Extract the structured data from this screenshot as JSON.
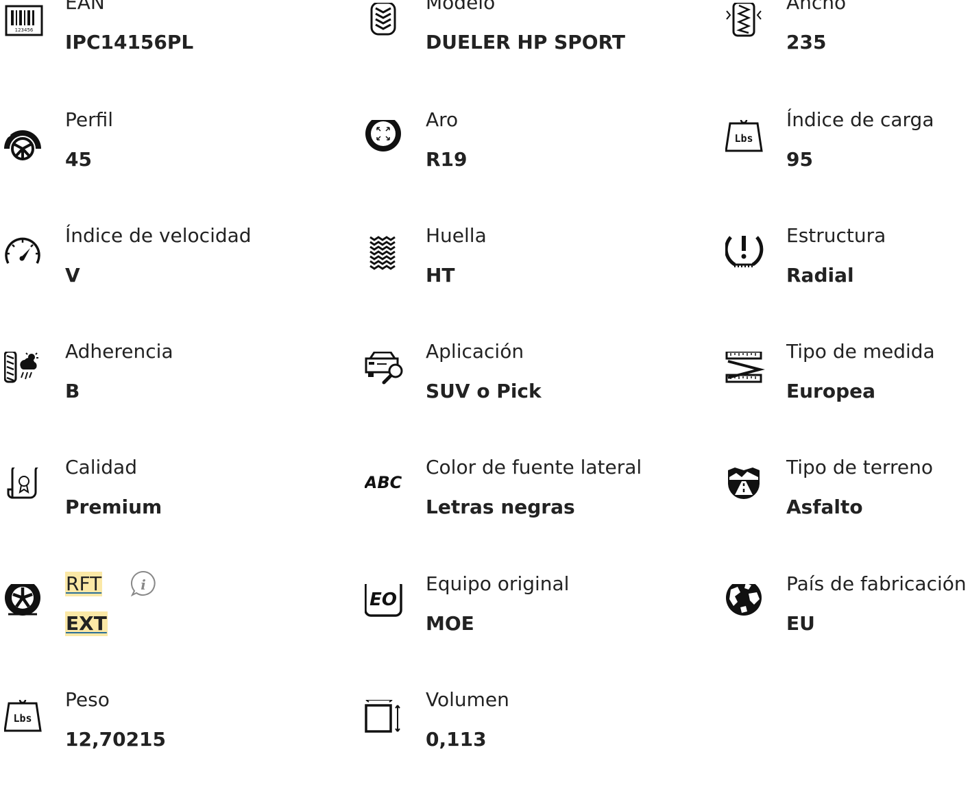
{
  "specs": [
    {
      "label": "EAN",
      "value": "IPC14156PL",
      "icon": "barcode-icon"
    },
    {
      "label": "Modelo",
      "value": "DUELER HP SPORT",
      "icon": "tire-tread-icon"
    },
    {
      "label": "Ancho",
      "value": "235",
      "icon": "tire-width-icon"
    },
    {
      "label": "Perfil",
      "value": "45",
      "icon": "tire-profile-icon"
    },
    {
      "label": "Aro",
      "value": "R19",
      "icon": "rim-icon"
    },
    {
      "label": "Índice de carga",
      "value": "95",
      "icon": "weight-icon"
    },
    {
      "label": "Índice de velocidad",
      "value": "V",
      "icon": "speedometer-icon"
    },
    {
      "label": "Huella",
      "value": "HT",
      "icon": "tread-pattern-icon"
    },
    {
      "label": "Estructura",
      "value": "Radial",
      "icon": "tire-warning-icon"
    },
    {
      "label": "Adherencia",
      "value": "B",
      "icon": "weather-grip-icon"
    },
    {
      "label": "Aplicación",
      "value": "SUV o Pick",
      "icon": "car-search-icon"
    },
    {
      "label": "Tipo de medida",
      "value": "Europea",
      "icon": "ruler-icon"
    },
    {
      "label": "Calidad",
      "value": "Premium",
      "icon": "certificate-icon"
    },
    {
      "label": "Color de fuente lateral",
      "value": "Letras negras",
      "icon": "abc-icon"
    },
    {
      "label": "Tipo de terreno",
      "value": "Asfalto",
      "icon": "road-terrain-icon"
    },
    {
      "label": "RFT",
      "value": "EXT",
      "icon": "wheel-icon"
    },
    {
      "label": "Equipo original",
      "value": "MOE",
      "icon": "eo-badge-icon"
    },
    {
      "label": "País de fabricación",
      "value": "EU",
      "icon": "globe-icon"
    },
    {
      "label": "Peso",
      "value": "12,70215",
      "icon": "weight-icon"
    },
    {
      "label": "Volumen",
      "value": "0,113",
      "icon": "volume-icon"
    }
  ],
  "icon_texts": {
    "barcode": "123456",
    "weight": "Lbs",
    "abc": "ABC",
    "eo": "EO",
    "info": "i"
  },
  "colors": {
    "text": "#222222",
    "highlight": "#fbe8a6",
    "link_underline": "#2a6f98",
    "info_icon": "#888888"
  }
}
